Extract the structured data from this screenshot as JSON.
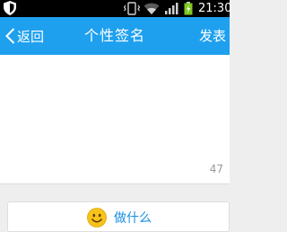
{
  "status_bar": {
    "time": "21:30",
    "icons": [
      "shield-icon",
      "vibrate-icon",
      "wifi-icon",
      "signal-icon",
      "battery-icon"
    ]
  },
  "header": {
    "back_label": "返回",
    "title": "个性签名",
    "publish_label": "发表"
  },
  "editor": {
    "text": "",
    "remaining_count": "47"
  },
  "action": {
    "icon": "smiley-icon",
    "label": "做什么"
  },
  "colors": {
    "header_bg": "#1ea0ef",
    "accent_text": "#1a8fe0",
    "page_bg": "#eeeeee"
  }
}
